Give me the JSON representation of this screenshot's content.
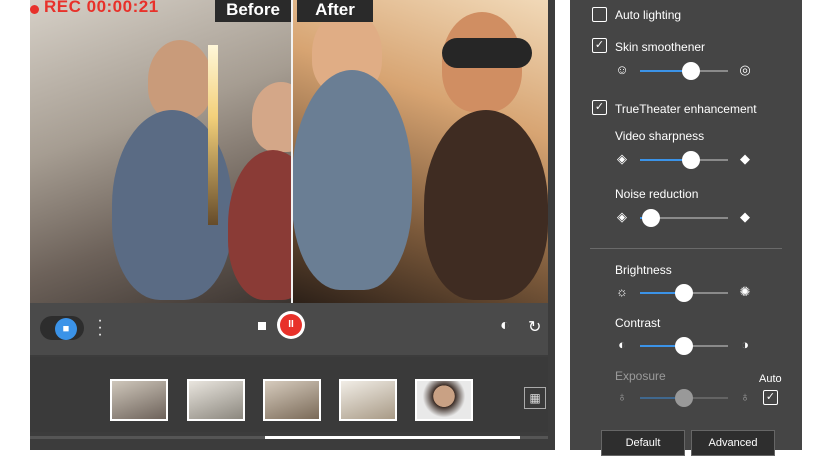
{
  "preview": {
    "rec_timer": "REC 00:00:21",
    "before_label": "Before",
    "after_label": "After"
  },
  "controls": {
    "camera_toggle": "camera-toggle",
    "record_button": "II"
  },
  "panel": {
    "auto_lighting": {
      "label": "Auto lighting",
      "checked": false
    },
    "skin_smoothener": {
      "label": "Skin smoothener",
      "checked": true,
      "value": 0.58
    },
    "truetheater": {
      "label": "TrueTheater enhancement",
      "checked": true
    },
    "video_sharpness": {
      "label": "Video sharpness",
      "value": 0.58
    },
    "noise_reduction": {
      "label": "Noise reduction",
      "value": 0.12
    },
    "brightness": {
      "label": "Brightness",
      "value": 0.5
    },
    "contrast": {
      "label": "Contrast",
      "value": 0.5
    },
    "exposure": {
      "label": "Exposure",
      "auto_label": "Auto",
      "auto_checked": true,
      "value": 0.5,
      "disabled": true
    },
    "default_button": "Default",
    "advanced_button": "Advanced"
  },
  "colors": {
    "accent": "#3b93e8",
    "record": "#e8312a",
    "panel_bg": "#454545"
  }
}
